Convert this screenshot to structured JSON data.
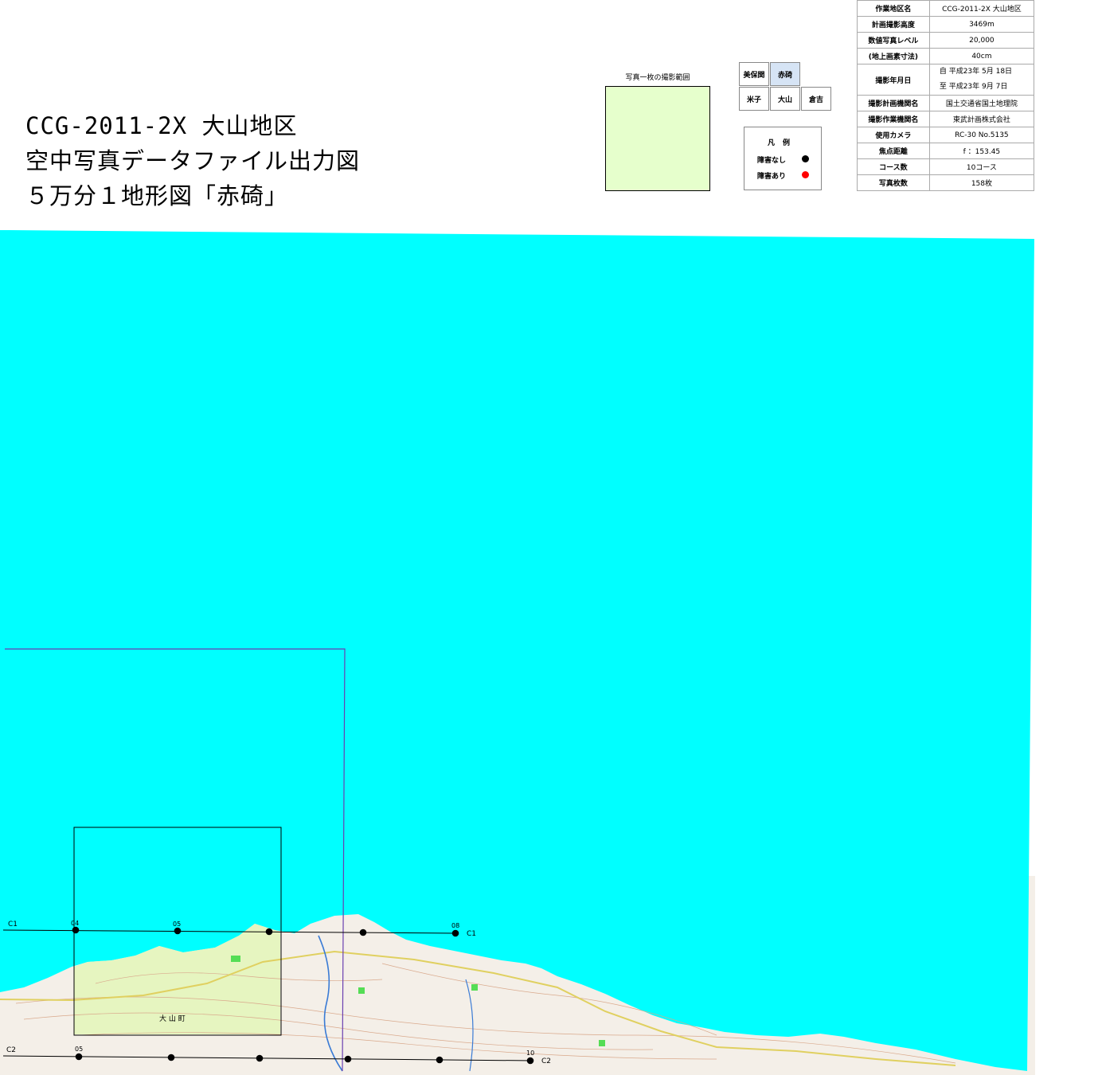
{
  "title": {
    "line1": "CCG-2011-2X 大山地区",
    "line2": "空中写真データファイル出力図",
    "line3": "５万分１地形図「赤碕」"
  },
  "coverage": {
    "label": "写真一枚の撮影範囲",
    "fill": "#e6ffcc"
  },
  "index_map": {
    "cells": [
      {
        "label": "美保関",
        "active": false
      },
      {
        "label": "赤碕",
        "active": true
      },
      {
        "label": "米子",
        "active": false
      },
      {
        "label": "大山",
        "active": false
      },
      {
        "label": "倉吉",
        "active": false
      }
    ],
    "active_color": "#d6e4f5"
  },
  "legend": {
    "title": "凡例",
    "items": [
      {
        "label": "障害なし",
        "color": "#000000"
      },
      {
        "label": "障害あり",
        "color": "#ff0000"
      }
    ]
  },
  "info": {
    "rows": [
      {
        "key": "作業地区名",
        "value": "CCG-2011-2X 大山地区"
      },
      {
        "key": "計画撮影高度",
        "value": "3469m"
      },
      {
        "key": "数値写真レベル",
        "value": "20,000"
      },
      {
        "key": "(地上画素寸法)",
        "value": "40cm"
      },
      {
        "key": "撮影年月日",
        "value": "自 平成23年 5月 18日",
        "value2": "至 平成23年 9月 7日"
      },
      {
        "key": "撮影計画機関名",
        "value": "国土交通省国土地理院"
      },
      {
        "key": "撮影作業機関名",
        "value": "東武計画株式会社"
      },
      {
        "key": "使用カメラ",
        "value": "RC-30 No.5135"
      },
      {
        "key": "焦点距離",
        "value": "f ：153.45"
      },
      {
        "key": "コース数",
        "value": "10コース"
      },
      {
        "key": "写真枚数",
        "value": "158枚"
      }
    ]
  },
  "map": {
    "sea_color": "#00ffff",
    "land_color": "#f4efe8",
    "highlight_color": "#e6f5c0",
    "sheet_border_color": "#6a3fb0",
    "courses": [
      {
        "name": "C1",
        "start_label": "C1",
        "end_label": "C1",
        "photo_labels": [
          "04",
          "05",
          "08"
        ]
      },
      {
        "name": "C2",
        "start_label": "C2",
        "end_label": "C2",
        "photo_labels": [
          "05",
          "10"
        ]
      }
    ],
    "town_label": "大 山 町"
  }
}
